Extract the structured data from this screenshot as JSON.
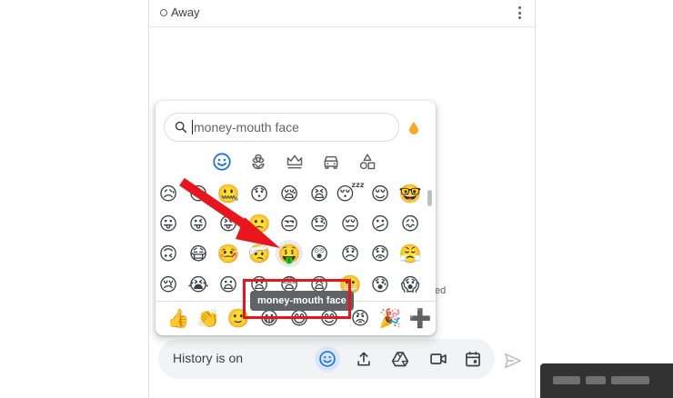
{
  "status": {
    "label": "Away",
    "status_icon": "circle-outline-icon",
    "menu_icon": "kebab-menu-icon"
  },
  "background": {
    "partial_text": "ed"
  },
  "emoji_picker": {
    "search": {
      "value": "money-mouth face",
      "icon": "search-icon"
    },
    "skin_tone_icon": "droplet-icon",
    "skin_tone_color": "#f9a825",
    "categories": [
      {
        "name": "smileys",
        "icon": "smiley-icon",
        "active": true
      },
      {
        "name": "nature",
        "icon": "flower-icon",
        "active": false
      },
      {
        "name": "objects",
        "icon": "crown-icon",
        "active": false
      },
      {
        "name": "travel",
        "icon": "car-icon",
        "active": false
      },
      {
        "name": "symbols",
        "icon": "shapes-icon",
        "active": false
      }
    ],
    "grid_rows": [
      [
        "😥",
        "😶",
        "🤐",
        "😯",
        "😪",
        "😫",
        "😴",
        "😌",
        "🤓"
      ],
      [
        "😛",
        "😜",
        "😝",
        "🙁",
        "😒",
        "😓",
        "😔",
        "😕",
        "😖"
      ],
      [
        "🙃",
        "😷",
        "🤒",
        "🤕",
        "🤑",
        "😲",
        "😞",
        "😟",
        "😤"
      ],
      [
        "😢",
        "😭",
        "😦",
        "😧",
        "😨",
        "😩",
        "😬",
        "😰",
        "😱"
      ]
    ],
    "hovered_emoji": "🤑",
    "tooltip": "money-mouth face",
    "frequent": [
      "👍",
      "👏",
      "🙂",
      "😀",
      "😄",
      "😊",
      "😡",
      "🎉",
      "➕"
    ]
  },
  "compose": {
    "placeholder": "History is on",
    "buttons": [
      {
        "name": "emoji",
        "icon": "smiley-icon",
        "active": true
      },
      {
        "name": "upload",
        "icon": "upload-icon",
        "active": false
      },
      {
        "name": "drive",
        "icon": "google-drive-icon",
        "active": false
      },
      {
        "name": "video",
        "icon": "video-camera-icon",
        "active": false
      },
      {
        "name": "calendar",
        "icon": "calendar-icon",
        "active": false
      }
    ],
    "send_icon": "send-icon"
  },
  "colors": {
    "accent": "#1a73e8",
    "annotation": "#e8151d",
    "tooltip_bg": "#5f6368",
    "compose_bg": "#f1f3f4"
  }
}
